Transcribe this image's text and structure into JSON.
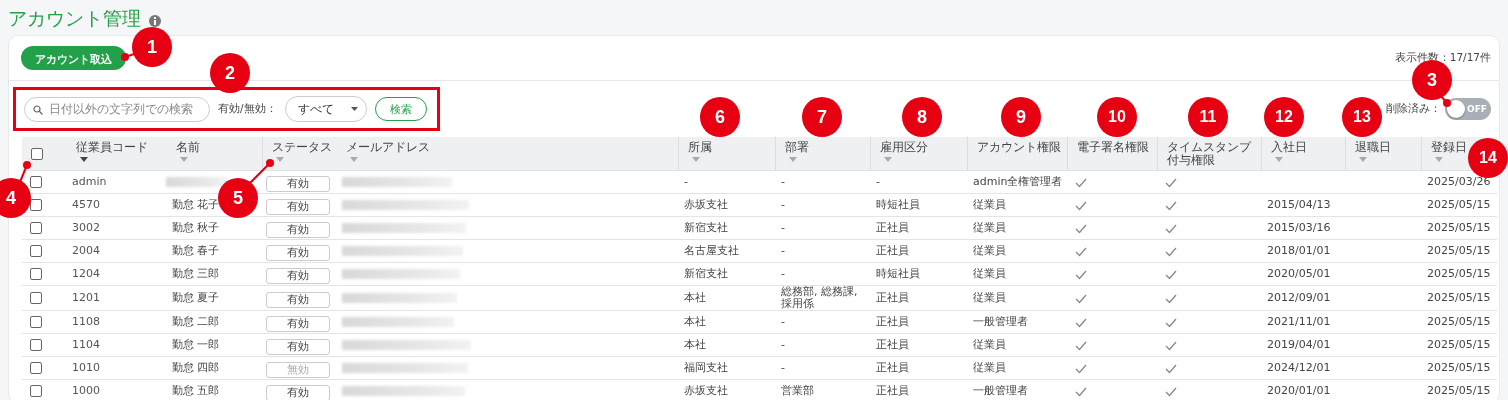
{
  "page": {
    "title": "アカウント管理"
  },
  "toolbar": {
    "import_button": "アカウント取込",
    "count": "表示件数：17/17件"
  },
  "filter_bar": {
    "highlighted": true,
    "search_placeholder": "日付以外の文字列での検索",
    "status_label": "有効/無効：",
    "status_value": "すべて",
    "search_button": "検索"
  },
  "deleted_toggle": {
    "label": "削除済み：",
    "on": false,
    "state_text": "OFF"
  },
  "table": {
    "header_checked": false,
    "columns": [
      {
        "label": "従業員コード",
        "sortable": true,
        "sort_active": true
      },
      {
        "label": "名前",
        "sortable": true,
        "sort_active": false
      },
      {
        "label": "ステータス",
        "sortable": true,
        "sort_active": false
      },
      {
        "label": "メールアドレス",
        "sortable": true,
        "sort_active": false
      },
      {
        "label": "所属",
        "sortable": true,
        "sort_active": false
      },
      {
        "label": "部署",
        "sortable": true,
        "sort_active": false
      },
      {
        "label": "雇用区分",
        "sortable": true,
        "sort_active": false
      },
      {
        "label": "アカウント権限",
        "sortable": false
      },
      {
        "label": "電子署名権限",
        "sortable": false
      },
      {
        "label": "タイムスタンプ付与権限",
        "sortable": false
      },
      {
        "label": "入社日",
        "sortable": true,
        "sort_active": false
      },
      {
        "label": "退職日",
        "sortable": true,
        "sort_active": false
      },
      {
        "label": "登録日",
        "sortable": true,
        "sort_active": false
      }
    ],
    "rows": [
      {
        "checked": false,
        "code": "admin",
        "name_hidden": true,
        "status": "有効",
        "disabled": false,
        "affiliation": "-",
        "department": "-",
        "employment": "-",
        "role": "admin全権管理者",
        "e_sign": true,
        "timestamp": true,
        "registered": "2025/03/26"
      },
      {
        "checked": false,
        "code": "4570",
        "name": "勤怠 花子",
        "status": "有効",
        "disabled": false,
        "affiliation": "赤坂支社",
        "department": "-",
        "employment": "時短社員",
        "role": "従業員",
        "e_sign": true,
        "timestamp": true,
        "hire_date": "2015/04/13",
        "registered": "2025/05/15"
      },
      {
        "checked": false,
        "code": "3002",
        "name": "勤怠 秋子",
        "status": "有効",
        "disabled": false,
        "affiliation": "新宿支社",
        "department": "-",
        "employment": "正社員",
        "role": "従業員",
        "e_sign": true,
        "timestamp": true,
        "hire_date": "2015/03/16",
        "registered": "2025/05/15"
      },
      {
        "checked": false,
        "code": "2004",
        "name": "勤怠 春子",
        "status": "有効",
        "disabled": false,
        "affiliation": "名古屋支社",
        "department": "-",
        "employment": "正社員",
        "role": "従業員",
        "e_sign": true,
        "timestamp": true,
        "hire_date": "2018/01/01",
        "registered": "2025/05/15"
      },
      {
        "checked": false,
        "code": "1204",
        "name": "勤怠 三郎",
        "status": "有効",
        "disabled": false,
        "affiliation": "新宿支社",
        "department": "-",
        "employment": "時短社員",
        "role": "従業員",
        "e_sign": true,
        "timestamp": true,
        "hire_date": "2020/05/01",
        "registered": "2025/05/15"
      },
      {
        "checked": false,
        "code": "1201",
        "name": "勤怠 夏子",
        "status": "有効",
        "disabled": false,
        "affiliation": "本社",
        "department": "総務部, 総務課, 採用係",
        "employment": "正社員",
        "role": "従業員",
        "e_sign": true,
        "timestamp": true,
        "hire_date": "2012/09/01",
        "registered": "2025/05/15"
      },
      {
        "checked": false,
        "code": "1108",
        "name": "勤怠 二郎",
        "status": "有効",
        "disabled": false,
        "affiliation": "本社",
        "department": "-",
        "employment": "正社員",
        "role": "一般管理者",
        "e_sign": true,
        "timestamp": true,
        "hire_date": "2021/11/01",
        "registered": "2025/05/15"
      },
      {
        "checked": false,
        "code": "1104",
        "name": "勤怠 一郎",
        "status": "有効",
        "disabled": false,
        "affiliation": "本社",
        "department": "-",
        "employment": "正社員",
        "role": "従業員",
        "e_sign": true,
        "timestamp": true,
        "hire_date": "2019/04/01",
        "registered": "2025/05/15"
      },
      {
        "checked": false,
        "code": "1010",
        "name": "勤怠 四郎",
        "status": "無効",
        "disabled": true,
        "affiliation": "福岡支社",
        "department": "-",
        "employment": "正社員",
        "role": "従業員",
        "e_sign": true,
        "timestamp": true,
        "hire_date": "2024/12/01",
        "registered": "2025/05/15"
      },
      {
        "checked": false,
        "code": "1000",
        "name": "勤怠 五郎",
        "status": "有効",
        "disabled": false,
        "affiliation": "赤坂支社",
        "department": "営業部",
        "employment": "正社員",
        "role": "一般管理者",
        "e_sign": true,
        "timestamp": true,
        "hire_date": "2020/01/01",
        "registered": "2025/05/15"
      }
    ]
  },
  "annotations": [
    {
      "label": "1"
    },
    {
      "label": "2"
    },
    {
      "label": "3"
    },
    {
      "label": "4"
    },
    {
      "label": "5"
    },
    {
      "label": "6"
    },
    {
      "label": "7"
    },
    {
      "label": "8"
    },
    {
      "label": "9"
    },
    {
      "label": "10"
    },
    {
      "label": "11"
    },
    {
      "label": "12"
    },
    {
      "label": "13"
    },
    {
      "label": "14"
    }
  ]
}
